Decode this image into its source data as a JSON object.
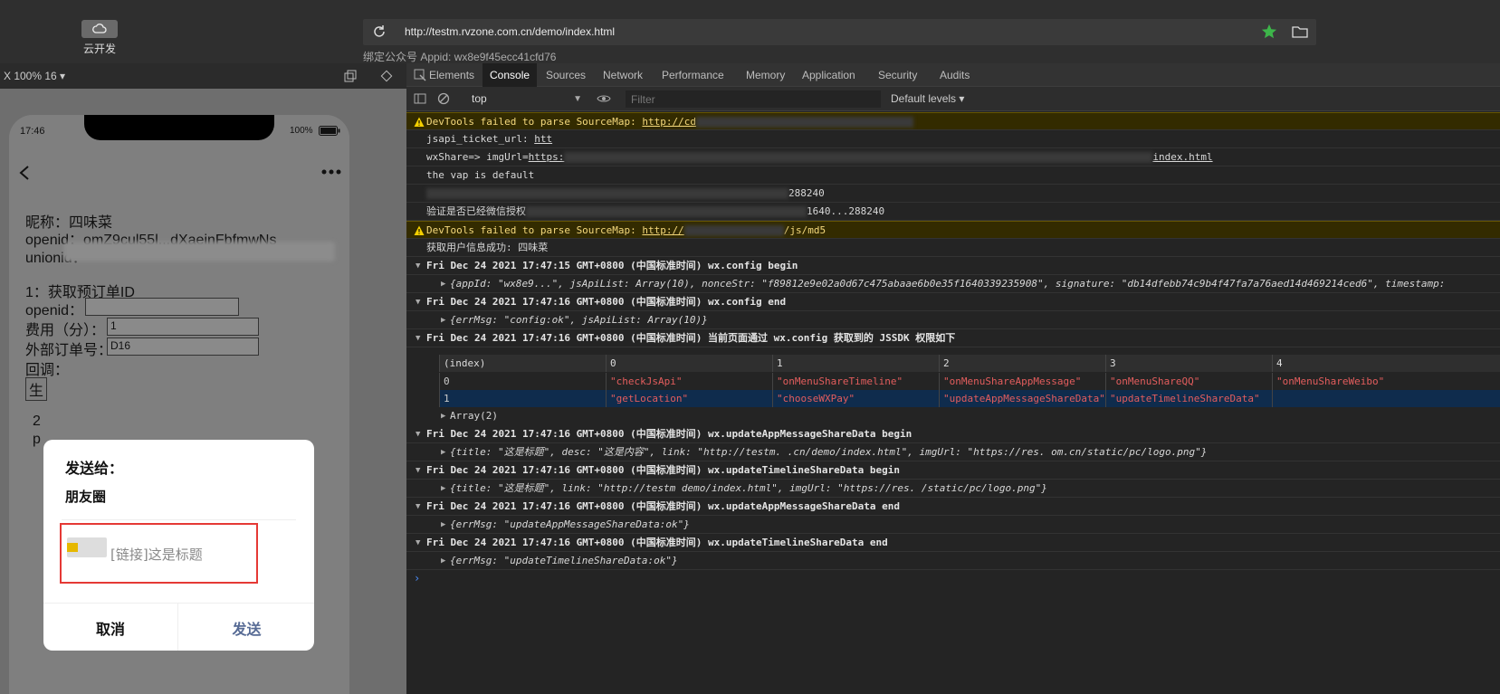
{
  "topbar": {
    "cloud_label": "云开发",
    "url": "http://testm.rvzone.com.cn/demo/index.html",
    "appid": "绑定公众号 Appid: wx8e9f45ecc41cfd76"
  },
  "simulator": {
    "zoom": "X 100% 16 ▾",
    "time": "17:46",
    "battery": "100%",
    "page": {
      "line1": "昵称：四味菜",
      "line2": "openid：omZ9cul55l...dXaeinFbfmwNs",
      "line3": "unionid：",
      "line4": "1：获取预订单ID",
      "line5": "openid：",
      "fee_label": "费用（分）：",
      "fee_value": "1",
      "order_label": "外部订单号：",
      "order_value": "D16",
      "line8": "回调：",
      "btn": "生",
      "line9": "2",
      "line10": "p"
    },
    "modal": {
      "title": "发送给：",
      "target": "朋友圈",
      "link_text": "[链接]这是标题",
      "cancel": "取消",
      "send": "发送"
    }
  },
  "devtools": {
    "tabs": [
      "Elements",
      "Console",
      "Sources",
      "Network",
      "Performance",
      "Memory",
      "Application",
      "Security",
      "Audits"
    ],
    "active_tab": "Console",
    "context": "top",
    "filter_placeholder": "Filter",
    "levels": "Default levels ▾",
    "console": {
      "warn1_prefix": "DevTools failed to parse SourceMap: ",
      "warn1_link": "http://cd",
      "l_jsapi_label": "jsapi_ticket_url: ",
      "l_jsapi_link": "htt",
      "l_share_label": "wxShare=> imgUrl=",
      "l_share_link": "https:",
      "l_share_tail": "index.html",
      "l_vap": "the vap is default",
      "l_openid_tail": "288240",
      "l_verify": "验证是否已经微信授权",
      "l_verify_tail": "1640...288240",
      "warn2_prefix": "DevTools failed to parse SourceMap: ",
      "warn2_link": "http://",
      "warn2_tail": "/js/md5",
      "l_userinfo": "获取用户信息成功: 四味菜",
      "g1": "Fri Dec 24 2021 17:47:15 GMT+0800 (中国标准时间) wx.config begin",
      "g1_obj": "{appId: \"wx8e9...\", jsApiList: Array(10), nonceStr: \"f89812e9e02a0d67c475abaae6b0e35f1640339235908\", signature: \"db14dfebb74c9b4f47fa7a76aed14d469214ced6\", timestamp:",
      "g2": "Fri Dec 24 2021 17:47:16 GMT+0800 (中国标准时间) wx.config end",
      "g2_obj": "{errMsg: \"config:ok\", jsApiList: Array(10)}",
      "g3": "Fri Dec 24 2021 17:47:16 GMT+0800 (中国标准时间) 当前页面通过 wx.config 获取到的 JSSDK 权限如下",
      "table": {
        "headers": [
          "(index)",
          "0",
          "1",
          "2",
          "3",
          "4"
        ],
        "rows": [
          [
            "0",
            "\"checkJsApi\"",
            "\"onMenuShareTimeline\"",
            "\"onMenuShareAppMessage\"",
            "\"onMenuShareQQ\"",
            "\"onMenuShareWeibo\""
          ],
          [
            "1",
            "\"getLocation\"",
            "\"chooseWXPay\"",
            "\"updateAppMessageShareData\"",
            "\"updateTimelineShareData\"",
            ""
          ]
        ]
      },
      "array2": "Array(2)",
      "g4": "Fri Dec 24 2021 17:47:16 GMT+0800 (中国标准时间) wx.updateAppMessageShareData begin",
      "g4_obj": "{title: \"这是标题\", desc: \"这是内容\", link: \"http://testm.          .cn/demo/index.html\", imgUrl: \"https://res.          om.cn/static/pc/logo.png\"}",
      "g5": "Fri Dec 24 2021 17:47:16 GMT+0800 (中国标准时间) wx.updateTimelineShareData begin",
      "g5_obj": "{title: \"这是标题\", link: \"http://testm          demo/index.html\", imgUrl: \"https://res.          /static/pc/logo.png\"}",
      "g6": "Fri Dec 24 2021 17:47:16 GMT+0800 (中国标准时间) wx.updateAppMessageShareData end",
      "g6_obj": "{errMsg: \"updateAppMessageShareData:ok\"}",
      "g7": "Fri Dec 24 2021 17:47:16 GMT+0800 (中国标准时间) wx.updateTimelineShareData end",
      "g7_obj": "{errMsg: \"updateTimelineShareData:ok\"}",
      "prompt": "›"
    }
  },
  "colors": {
    "accent_star": "#3db54a",
    "modal_send": "#576b95",
    "highlight_border": "#e53935",
    "string_red": "#e35d5d",
    "warn_bg": "#332b00"
  }
}
